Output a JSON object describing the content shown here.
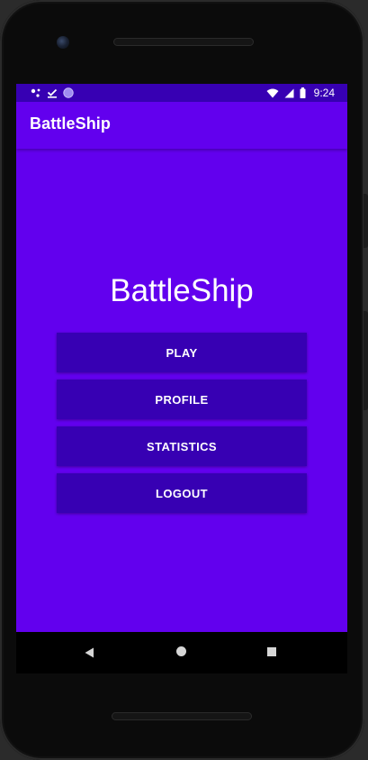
{
  "status_bar": {
    "time": "9:24",
    "icons_left": [
      "notification-dots-icon",
      "download-done-icon",
      "circle-icon"
    ],
    "icons_right": [
      "wifi-icon",
      "signal-icon",
      "battery-icon"
    ]
  },
  "app_bar": {
    "title": "BattleShip"
  },
  "main": {
    "title": "BattleShip",
    "buttons": [
      {
        "label": "PLAY"
      },
      {
        "label": "PROFILE"
      },
      {
        "label": "STATISTICS"
      },
      {
        "label": "LOGOUT"
      }
    ]
  },
  "nav_bar": {
    "icons": [
      "back-icon",
      "home-icon",
      "recents-icon"
    ]
  },
  "colors": {
    "primary": "#6200ee",
    "primary_dark": "#3700b3",
    "on_primary": "#ffffff"
  }
}
